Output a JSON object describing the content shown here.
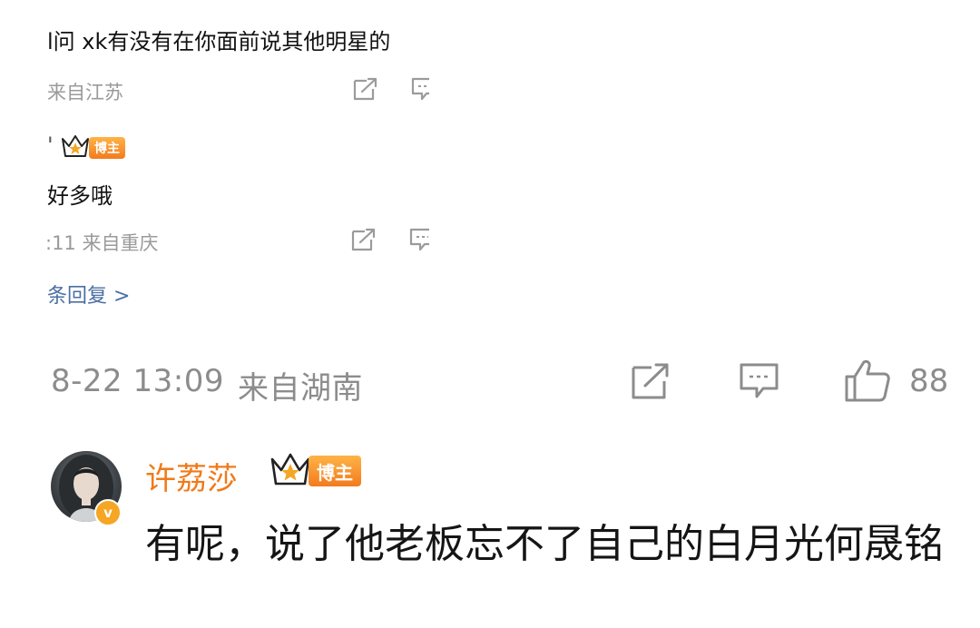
{
  "nested_replies": {
    "reply1": {
      "text": "l问 xk有没有在你面前说其他明星的",
      "meta": "来自江苏"
    },
    "reply2": {
      "author_prefix": "'",
      "badge_label": "博主",
      "text": "好多哦",
      "meta": ":11  来自重庆"
    },
    "more_replies_label": "条回复 >"
  },
  "parent_comment_meta": {
    "timestamp": "8-22 13:09",
    "location": "来自湖南",
    "like_count": "88"
  },
  "author_comment": {
    "username": "许荔莎",
    "badge_label": "博主",
    "verified_mark": "v",
    "text": "有呢，说了他老板忘不了自己的白月光何晟铭"
  },
  "icons": [
    "share-icon",
    "comment-icon",
    "like-icon",
    "crown-icon",
    "verified-icon",
    "avatar"
  ],
  "colors": {
    "username": "#f07a1a",
    "badge_gradient_top": "#ffb347",
    "badge_gradient_bottom": "#f27b1d",
    "meta_text": "#8c8c8c",
    "reply_link": "#4a6fa3"
  }
}
